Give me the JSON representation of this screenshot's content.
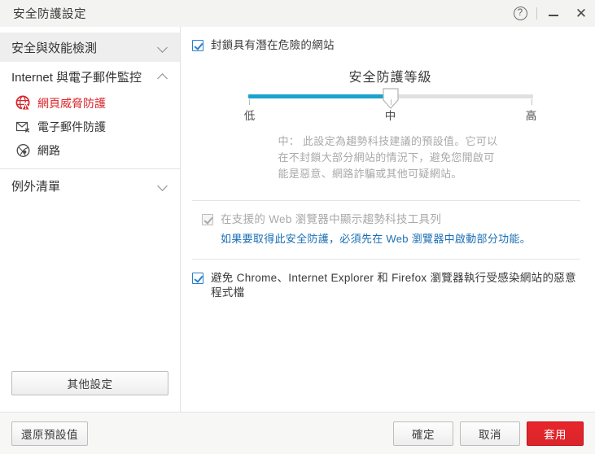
{
  "window": {
    "title": "安全防護設定",
    "help_icon": "question-mark-icon",
    "minimize_icon": "minimize-icon",
    "close_icon": "close-icon"
  },
  "sidebar": {
    "groups": [
      {
        "label": "安全與效能檢測",
        "chevron": "chevron-down-icon",
        "selected": true
      },
      {
        "label": "Internet 與電子郵件監控",
        "chevron": "chevron-up-icon",
        "selected": false
      },
      {
        "label": "例外清單",
        "chevron": "chevron-down-icon",
        "selected": false
      }
    ],
    "items": [
      {
        "label": "網頁威脅防護",
        "icon": "globe-warning-icon",
        "active": true
      },
      {
        "label": "電子郵件防護",
        "icon": "envelope-block-icon",
        "active": false
      },
      {
        "label": "網路",
        "icon": "network-globe-icon",
        "active": false
      }
    ],
    "other_settings_button": "其他設定"
  },
  "main": {
    "block_sites_checkbox": {
      "label": "封鎖具有潛在危險的網站",
      "checked": true,
      "disabled": false
    },
    "slider": {
      "title": "安全防護等級",
      "labels": {
        "low": "低",
        "medium": "中",
        "high": "高"
      },
      "value": "中",
      "fill_percent": 50,
      "fill_color": "#1aa3cd",
      "track_color": "#e0e0e0",
      "description": "中： 此設定為趨勢科技建議的預設值。它可以在不封鎖大部分網站的情況下，避免您開啟可能是惡意、網路詐騙或其他可疑網站。"
    },
    "toolbar_checkbox": {
      "label": "在支援的 Web 瀏覽器中顯示趨勢科技工具列",
      "checked": true,
      "disabled": true
    },
    "toolbar_link": "如果要取得此安全防護，必須先在 Web 瀏覽器中啟動部分功能。",
    "malware_checkbox": {
      "label": "避免 Chrome、Internet Explorer 和 Firefox 瀏覽器執行受感染網站的惡意程式檔",
      "checked": true,
      "disabled": false
    }
  },
  "footer": {
    "restore_defaults": "還原預設值",
    "ok": "確定",
    "cancel": "取消",
    "apply": "套用",
    "apply_color": "#d9252a"
  }
}
